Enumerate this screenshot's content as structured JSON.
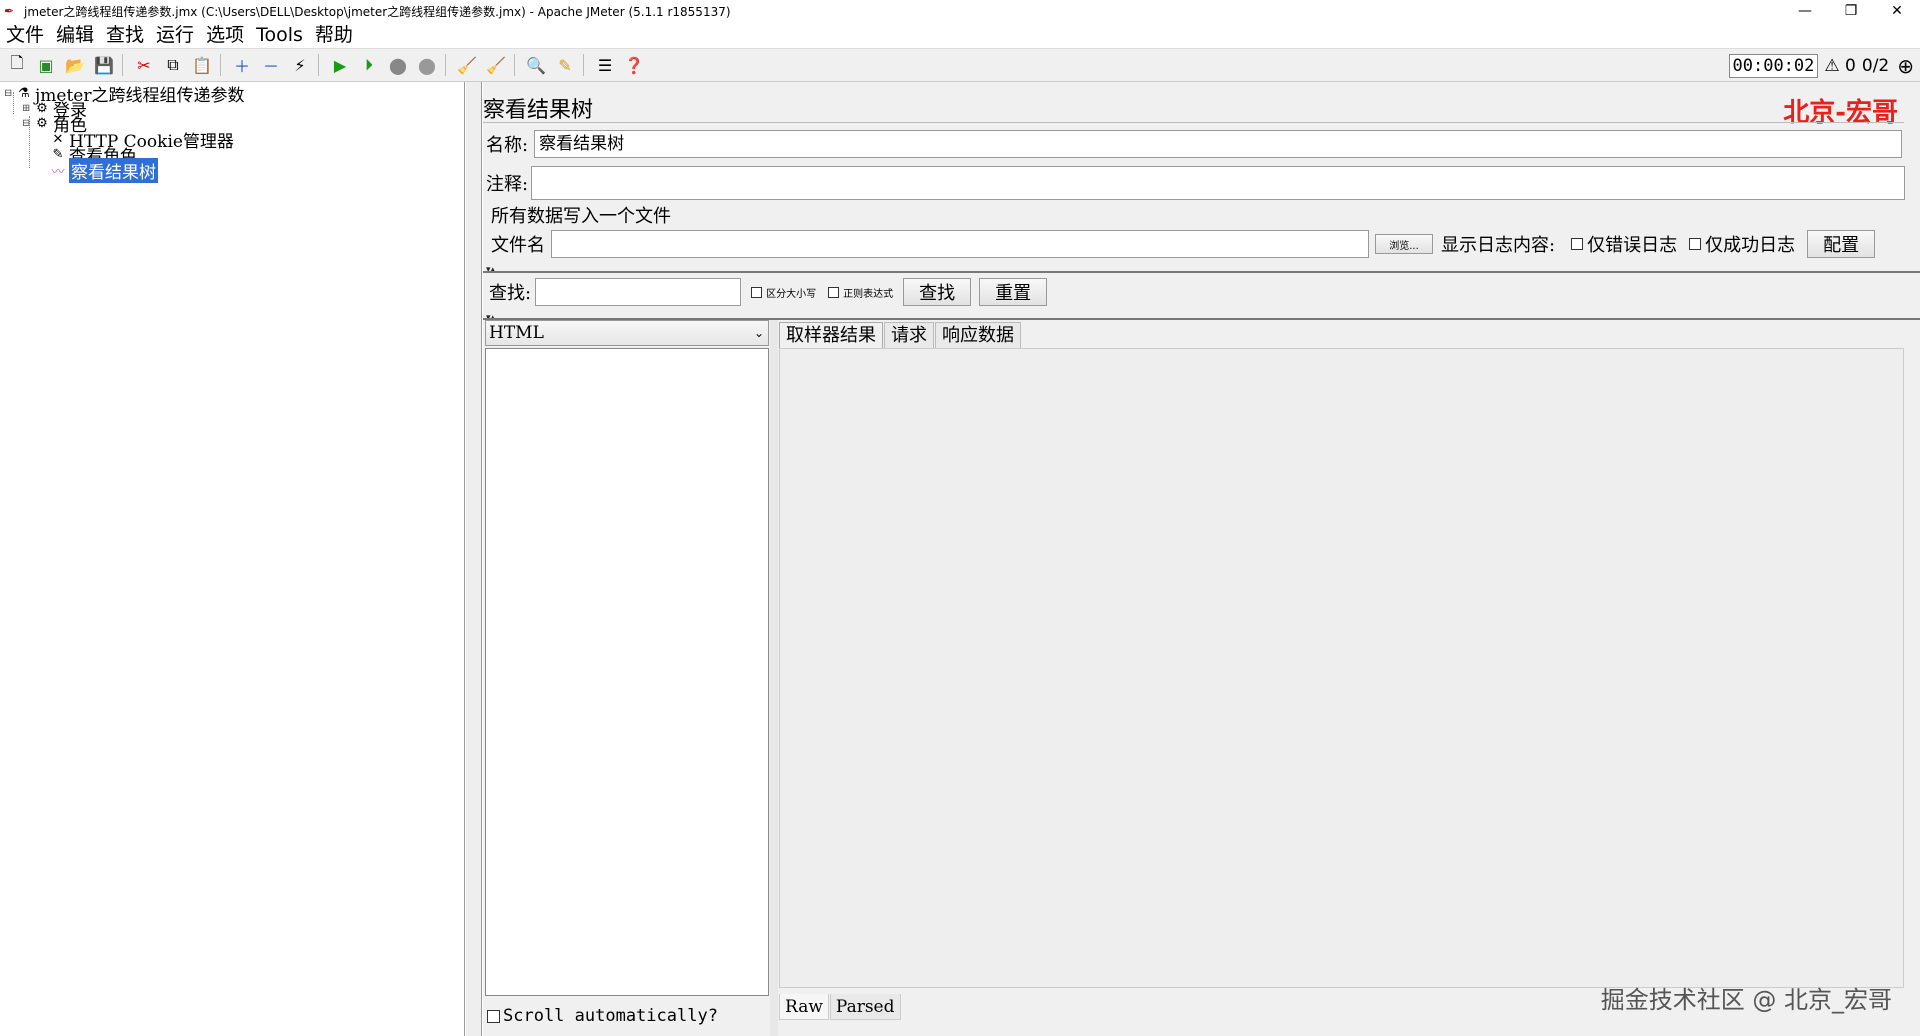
{
  "window": {
    "title": "jmeter之跨线程组传递参数.jmx (C:\\Users\\DELL\\Desktop\\jmeter之跨线程组传递参数.jmx) - Apache JMeter (5.1.1 r1855137)",
    "controls": [
      "—",
      "❐",
      "✕"
    ]
  },
  "menu": [
    "文件",
    "编辑",
    "查找",
    "运行",
    "选项",
    "Tools",
    "帮助"
  ],
  "toolbar": {
    "timer": "00:00:02",
    "warnings": "0",
    "threads": "0/2"
  },
  "tree": {
    "root": "jmeter之跨线程组传递参数",
    "items": [
      {
        "label": "登录"
      },
      {
        "label": "角色"
      },
      {
        "label": "HTTP Cookie管理器"
      },
      {
        "label": "查看角色"
      },
      {
        "label": "察看结果树"
      }
    ]
  },
  "panel": {
    "title": "察看结果树",
    "brand": "北京-宏哥",
    "name_label": "名称:",
    "name_value": "察看结果树",
    "comment_label": "注释:",
    "group_label": "所有数据写入一个文件",
    "file_label": "文件名",
    "browse_button": "浏览...",
    "log_label": "显示日志内容:",
    "errors_only": "仅错误日志",
    "success_only": "仅成功日志",
    "config_button": "配置",
    "search_label": "查找:",
    "case_sensitive": "区分大小写",
    "regex": "正则表达式",
    "search_button": "查找",
    "reset_button": "重置",
    "renderer": "HTML",
    "scroll_auto": "Scroll automatically?",
    "tabs": [
      "取样器结果",
      "请求",
      "响应数据"
    ],
    "bottom_tabs": [
      "Raw",
      "Parsed"
    ],
    "watermark": "掘金技术社区 @ 北京_宏哥"
  },
  "colors": {
    "brand": "#e8221b",
    "selection": "#2f6fd6"
  }
}
